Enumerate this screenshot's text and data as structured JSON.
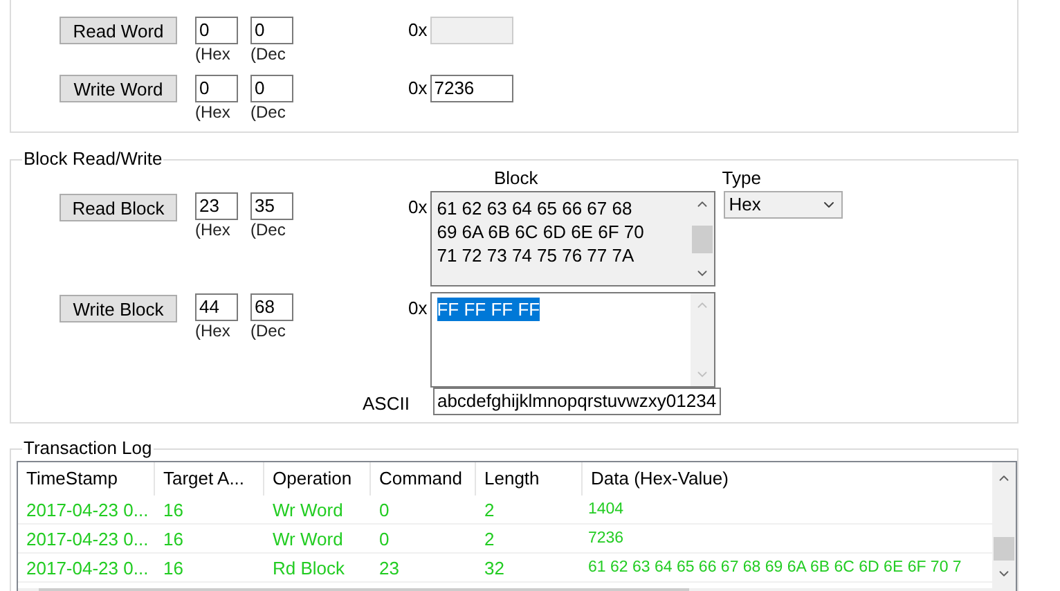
{
  "word_section": {
    "rows": [
      {
        "button": "Read Word",
        "hex": "0",
        "hex_label": "(Hex",
        "dec": "0",
        "dec_label": "(Dec",
        "prefix": "0x",
        "read_only": true
      },
      {
        "button": "Write Word",
        "hex": "0",
        "hex_label": "(Hex",
        "dec": "0",
        "dec_label": "(Dec",
        "prefix": "0x",
        "value": "7236",
        "read_only": false
      }
    ]
  },
  "block_section": {
    "title": "Block Read/Write",
    "block_label": "Block",
    "type_label": "Type",
    "type_value": "Hex",
    "rows": [
      {
        "button": "Read Block",
        "hex": "23",
        "hex_label": "(Hex",
        "dec": "35",
        "dec_label": "(Dec",
        "prefix": "0x",
        "lines": [
          "61 62 63 64 65 66 67 68",
          "69 6A 6B 6C 6D 6E 6F 70",
          "71 72 73 74 75 76 77 7A"
        ],
        "read_only": true,
        "text_selected": false
      },
      {
        "button": "Write Block",
        "hex": "44",
        "hex_label": "(Hex",
        "dec": "68",
        "dec_label": "(Dec",
        "prefix": "0x",
        "lines": [
          "FF FF FF FF"
        ],
        "read_only": false,
        "text_selected": true
      }
    ],
    "ascii_label": "ASCII",
    "ascii_value": "abcdefghijklmnopqrstuvwzxy01234"
  },
  "transaction_log": {
    "title": "Transaction Log",
    "columns": [
      "TimeStamp",
      "Target A...",
      "Operation",
      "Command",
      "Length",
      "Data (Hex-Value)"
    ],
    "rows": [
      [
        "2017-04-23 0...",
        "16",
        "Wr Word",
        "0",
        "2",
        "1404"
      ],
      [
        "2017-04-23 0...",
        "16",
        "Wr Word",
        "0",
        "2",
        "7236"
      ],
      [
        "2017-04-23 0...",
        "16",
        "Rd Block",
        "23",
        "32",
        "61 62 63 64 65 66 67 68 69 6A 6B 6C 6D 6E 6F 70 7"
      ]
    ]
  }
}
